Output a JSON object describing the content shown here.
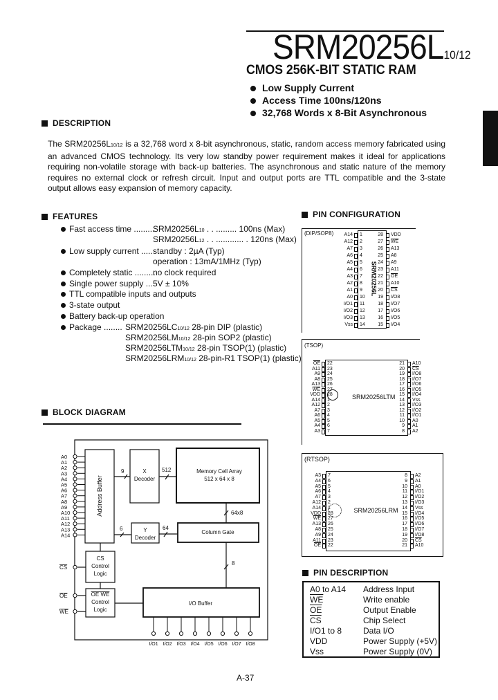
{
  "header": {
    "title": "SRM20256L",
    "title_suffix": "10/12",
    "subtitle": "CMOS 256K-BIT STATIC RAM",
    "highlights": [
      "Low Supply Current",
      "Access Time 100ns/120ns",
      "32,768 Words x 8-Bit Asynchronous"
    ]
  },
  "description": {
    "heading": "DESCRIPTION",
    "part": "SRM20256L",
    "part_suffix": "10/12",
    "text": " is a 32,768 word x 8-bit asynchronous, static, random access memory fabricated using an advanced CMOS technology.  Its very low standby power requirement makes it ideal for applications requiring non-volatile storage with back-up batteries.  The asynchronous and static nature of the memory requires no external clock or refresh circuit.  Input and output ports are TTL compatible and the 3-state output allows easy expansion of memory capacity."
  },
  "features": {
    "heading": "FEATURES",
    "items": [
      {
        "label": "Fast access time .........",
        "value": "SRM20256L",
        "sub": "10",
        "tail": " . .  ......... 100ns (Max)"
      },
      {
        "label": "",
        "value": "SRM20256L",
        "sub": "12",
        "tail": " . . ............ . 120ns (Max)"
      },
      {
        "label": "Low supply current .....",
        "value": "standby :  2µA (Typ)"
      },
      {
        "label": "",
        "value": "operation :  13mA/1MHz (Typ)"
      },
      {
        "label": "Completely static .........",
        "value": "no clock required"
      },
      {
        "label": "Single power supply ...",
        "value": "5V ± 10%"
      },
      {
        "label": "TTL compatible inputs and outputs"
      },
      {
        "label": "3-state output"
      },
      {
        "label": "Battery back-up operation"
      },
      {
        "label": "Package ........",
        "value": "SRM20256LC",
        "sub": "10/12",
        "tail": " 28-pin DIP (plastic)"
      },
      {
        "label": "",
        "value": "SRM20256LM",
        "sub": "10/12",
        "tail": " 28-pin SOP2 (plastic)"
      },
      {
        "label": "",
        "value": "SRM20256LTM",
        "sub": "10/12",
        "tail": "  28-pin TSOP(1) (plastic)"
      },
      {
        "label": "",
        "value": "SRM20256LRM",
        "sub": "10/12",
        "tail": "  28-pin-R1 TSOP(1) (plastic)"
      }
    ]
  },
  "pin_configuration": {
    "heading": "PIN CONFIGURATION",
    "dip": {
      "label": "(DIP/SOP8)",
      "chip": "SRM20256L",
      "left": [
        [
          "1",
          "A14"
        ],
        [
          "2",
          "A12"
        ],
        [
          "3",
          "A7"
        ],
        [
          "4",
          "A6"
        ],
        [
          "5",
          "A5"
        ],
        [
          "6",
          "A4"
        ],
        [
          "7",
          "A3"
        ],
        [
          "8",
          "A2"
        ],
        [
          "9",
          "A1"
        ],
        [
          "10",
          "A0"
        ],
        [
          "11",
          "I/O1"
        ],
        [
          "12",
          "I/O2"
        ],
        [
          "13",
          "I/O3"
        ],
        [
          "14",
          "Vss"
        ]
      ],
      "right": [
        [
          "28",
          "VDD"
        ],
        [
          "27",
          "WE"
        ],
        [
          "26",
          "A13"
        ],
        [
          "25",
          "A8"
        ],
        [
          "24",
          "A9"
        ],
        [
          "23",
          "A11"
        ],
        [
          "22",
          "OE"
        ],
        [
          "21",
          "A10"
        ],
        [
          "20",
          "CS"
        ],
        [
          "19",
          "I/O8"
        ],
        [
          "18",
          "I/O7"
        ],
        [
          "17",
          "I/O6"
        ],
        [
          "16",
          "I/O5"
        ],
        [
          "15",
          "I/O4"
        ]
      ]
    },
    "tsop": {
      "label": "(TSOP)",
      "chip": "SRM20256LTM",
      "left": [
        [
          "22",
          "OE"
        ],
        [
          "23",
          "A11"
        ],
        [
          "24",
          "A9"
        ],
        [
          "25",
          "A8"
        ],
        [
          "26",
          "A13"
        ],
        [
          "27",
          "WE"
        ],
        [
          "28",
          "VDD"
        ],
        [
          "1",
          "A14"
        ],
        [
          "2",
          "A12"
        ],
        [
          "3",
          "A7"
        ],
        [
          "4",
          "A6"
        ],
        [
          "5",
          "A5"
        ],
        [
          "6",
          "A4"
        ],
        [
          "7",
          "A3"
        ]
      ],
      "right": [
        [
          "21",
          "A10"
        ],
        [
          "20",
          "CS"
        ],
        [
          "19",
          "I/O8"
        ],
        [
          "18",
          "I/O7"
        ],
        [
          "17",
          "I/O6"
        ],
        [
          "16",
          "I/O5"
        ],
        [
          "15",
          "I/O4"
        ],
        [
          "14",
          "Vss"
        ],
        [
          "13",
          "I/O3"
        ],
        [
          "12",
          "I/O2"
        ],
        [
          "11",
          "I/O1"
        ],
        [
          "10",
          "A0"
        ],
        [
          "9",
          "A1"
        ],
        [
          "8",
          "A2"
        ]
      ]
    },
    "rtsop": {
      "label": "(RTSOP)",
      "chip": "SRM20256LRM",
      "left": [
        [
          "7",
          "A3"
        ],
        [
          "6",
          "A4"
        ],
        [
          "5",
          "A5"
        ],
        [
          "4",
          "A6"
        ],
        [
          "3",
          "A7"
        ],
        [
          "2",
          "A12"
        ],
        [
          "1",
          "A14"
        ],
        [
          "28",
          "VDD"
        ],
        [
          "27",
          "WE"
        ],
        [
          "26",
          "A13"
        ],
        [
          "25",
          "A8"
        ],
        [
          "24",
          "A9"
        ],
        [
          "23",
          "A11"
        ],
        [
          "22",
          "OE"
        ]
      ],
      "right": [
        [
          "8",
          "A2"
        ],
        [
          "9",
          "A1"
        ],
        [
          "10",
          "A0"
        ],
        [
          "11",
          "I/O1"
        ],
        [
          "12",
          "I/O2"
        ],
        [
          "13",
          "I/O3"
        ],
        [
          "14",
          "Vss"
        ],
        [
          "15",
          "I/O4"
        ],
        [
          "16",
          "I/O5"
        ],
        [
          "17",
          "I/O6"
        ],
        [
          "18",
          "I/O7"
        ],
        [
          "19",
          "I/O8"
        ],
        [
          "20",
          "CS"
        ],
        [
          "21",
          "A10"
        ]
      ]
    }
  },
  "block_diagram": {
    "heading": "BLOCK DIAGRAM",
    "address_pins": [
      "A0",
      "A1",
      "A2",
      "A3",
      "A4",
      "A5",
      "A6",
      "A7",
      "A8",
      "A9",
      "A10",
      "A11",
      "A12",
      "A13",
      "A14"
    ],
    "address_buffer": "Address Buffer",
    "x_decoder": [
      "X",
      "Decoder"
    ],
    "y_decoder": [
      "Y",
      "Decoder"
    ],
    "memory_array": [
      "Memory Cell Array",
      "512 x 64 x 8"
    ],
    "column_gate": "Column Gate",
    "cs_logic": [
      "CS",
      "Control",
      "Logic"
    ],
    "oewe_logic": [
      "OE WE",
      "Control",
      "Logic"
    ],
    "io_buffer": "I/O Buffer",
    "bus_labels": {
      "x": "9",
      "x_out": "512",
      "y": "6",
      "y_out": "64",
      "array_col": "64x8",
      "io": "8"
    },
    "control_pins": [
      "CS",
      "OE",
      "WE"
    ],
    "io_pins": [
      "I/O1",
      "I/O2",
      "I/O3",
      "I/O4",
      "I/O5",
      "I/O6",
      "I/O7",
      "I/O8"
    ]
  },
  "pin_description": {
    "heading": "PIN DESCRIPTION",
    "rows": [
      [
        "A0 to A14",
        "Address Input"
      ],
      [
        "WE",
        "Write enable"
      ],
      [
        "OE",
        "Output Enable"
      ],
      [
        "CS",
        "Chip Select"
      ],
      [
        "I/O1 to 8",
        "Data I/O"
      ],
      [
        "VDD",
        "Power Supply (+5V)"
      ],
      [
        "Vss",
        "Power Supply (0V)"
      ]
    ]
  },
  "footer": {
    "page": "A-37"
  }
}
